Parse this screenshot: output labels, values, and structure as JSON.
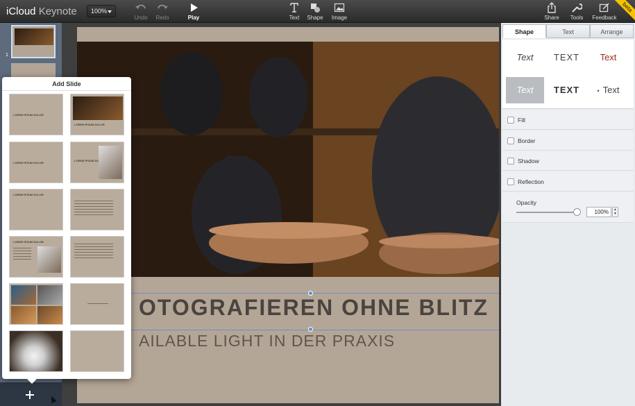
{
  "app": {
    "title_bold": "iCloud",
    "title_light": "Keynote"
  },
  "toolbar": {
    "zoom": "100%",
    "undo": "Undo",
    "redo": "Redo",
    "play": "Play",
    "text": "Text",
    "shape": "Shape",
    "image": "Image",
    "share": "Share",
    "tools": "Tools",
    "feedback": "Feedback",
    "beta": "beta"
  },
  "navigator": {
    "slides": [
      {
        "number": "1",
        "selected": true
      },
      {
        "number": "2",
        "selected": false
      }
    ],
    "add_icon": "plus-icon"
  },
  "slide": {
    "title": "OTOGRAFIEREN OHNE BLITZ",
    "subtitle": "AILABLE LIGHT IN DER PRAXIS"
  },
  "add_slide": {
    "title": "Add Slide",
    "layouts": [
      {
        "label": "LOREM IPSUM DOLOR"
      },
      {
        "label": "LOREM IPSUM DOLOR"
      },
      {
        "label": "LOREM IPSUM DOLOR"
      },
      {
        "label": "LOREM IPSUM DOLOR"
      },
      {
        "label": "LOREM IPSUM DOLOR"
      },
      {
        "label": ""
      },
      {
        "label": "LOREM IPSUM DOLOR"
      },
      {
        "label": ""
      },
      {
        "label": ""
      },
      {
        "label": ""
      },
      {
        "label": ""
      },
      {
        "label": ""
      }
    ]
  },
  "inspector": {
    "tabs": [
      "Shape",
      "Text",
      "Arrange"
    ],
    "active_tab": "Shape",
    "text_styles": [
      "Text",
      "TEXT",
      "Text",
      "Text",
      "TEXT",
      "Text"
    ],
    "options": [
      "Fill",
      "Border",
      "Shadow",
      "Reflection"
    ],
    "opacity_label": "Opacity",
    "opacity_value": "100%"
  }
}
